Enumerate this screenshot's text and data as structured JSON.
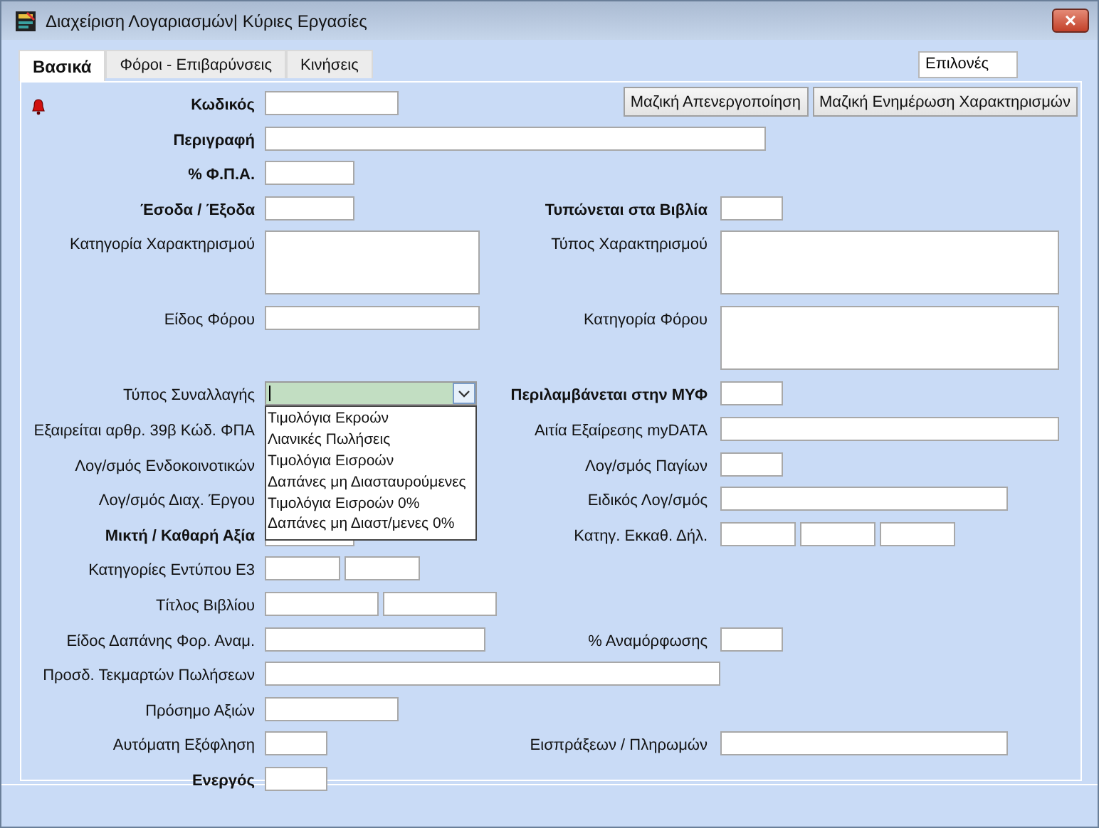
{
  "window": {
    "title": "Διαχείριση Λογαριασμών| Κύριες Εργασίες",
    "close": "×"
  },
  "tabs": [
    {
      "label": "Βασικά",
      "selected": true
    },
    {
      "label": "Φόροι - Επιβαρύνσεις",
      "selected": false
    },
    {
      "label": "Κινήσεις",
      "selected": false
    }
  ],
  "options_box": "Επιλονές",
  "toolbar": [
    "Μαζική Απενεργοποίηση",
    "Μαζική Ενημέρωση Χαρακτηρισμών"
  ],
  "rows": [
    {
      "left": {
        "label": "Κωδικός",
        "bold": true,
        "fields": [
          {
            "kind": "medium"
          }
        ]
      }
    },
    {
      "left": {
        "label": "Περιγραφή",
        "bold": true,
        "fields": [
          {
            "kind": "fullest"
          }
        ]
      }
    },
    {
      "left": {
        "label": "% Φ.Π.Α.",
        "bold": true,
        "fields": [
          {
            "kind": "short"
          }
        ]
      }
    },
    {
      "left": {
        "label": "Έσοδα / Έξοδα",
        "bold": true,
        "fields": [
          {
            "kind": "short"
          }
        ]
      },
      "right": {
        "label": "Τυπώνεται στα Βιβλία",
        "bold": true,
        "fields": [
          {
            "kind": "tiny"
          }
        ]
      }
    },
    {
      "left": {
        "label": "Κατηγορία Χαρακτηρισμού",
        "bold": false,
        "fields": [
          {
            "kind": "area-wide"
          }
        ]
      },
      "right": {
        "label": "Τύπος Χαρακτηρισμού",
        "bold": false,
        "fields": [
          {
            "kind": "area-long"
          }
        ]
      }
    },
    {
      "left": {
        "label": "Είδος Φόρου",
        "bold": false,
        "fields": [
          {
            "kind": "wide"
          }
        ]
      },
      "right": {
        "label": "Κατηγορία Φόρου",
        "bold": false,
        "fields": [
          {
            "kind": "area-long"
          }
        ]
      }
    },
    {
      "left": {
        "label": "Τύπος Συναλλαγής",
        "bold": false,
        "fields": [
          {
            "kind": "combo"
          }
        ]
      },
      "right": {
        "label": "Περιλαμβάνεται στην ΜΥΦ",
        "bold": true,
        "fields": [
          {
            "kind": "tiny"
          }
        ]
      }
    },
    {
      "left": {
        "label": "Εξαιρείται αρθρ. 39β Κώδ. ΦΠΑ",
        "bold": false
      },
      "right": {
        "label": "Αιτία Εξαίρεσης myDATA",
        "bold": false,
        "fields": [
          {
            "kind": "longer"
          }
        ]
      }
    },
    {
      "left": {
        "label": "Λογ/σμός Ενδοκοινοτικών",
        "bold": false
      },
      "right": {
        "label": "Λογ/σμός  Παγίων",
        "bold": false,
        "fields": [
          {
            "kind": "tiny"
          }
        ]
      }
    },
    {
      "left": {
        "label": "Λογ/σμός Διαχ. Έργου",
        "bold": false
      },
      "right": {
        "label": "Ειδικός Λογ/σμός",
        "bold": false,
        "fields": [
          {
            "kind": "long"
          }
        ]
      }
    },
    {
      "left": {
        "label": "Μικτή  / Καθαρή Αξία",
        "bold": true,
        "fields": [
          {
            "kind": "short"
          }
        ]
      },
      "right": {
        "label": "Κατηγ. Εκκαθ. Δήλ.",
        "bold": false,
        "fields": [
          {
            "kind": "small"
          },
          {
            "kind": "small"
          },
          {
            "kind": "small"
          }
        ]
      }
    },
    {
      "left": {
        "label": "Κατηγορίες Εντύπου Ε3",
        "bold": false,
        "fields": [
          {
            "kind": "small"
          },
          {
            "kind": "small"
          }
        ]
      }
    },
    {
      "left": {
        "label": "Τίτλος Βιβλίου",
        "bold": false,
        "fields": [
          {
            "kind": "compact"
          },
          {
            "kind": "compact"
          }
        ]
      }
    },
    {
      "left": {
        "label": "Είδος Δαπάνης Φορ. Αναμ.",
        "bold": false,
        "fields": [
          {
            "kind": "wider"
          }
        ]
      },
      "right": {
        "label": "% Αναμόρφωσης",
        "bold": false,
        "fields": [
          {
            "kind": "tiny"
          }
        ]
      }
    },
    {
      "left": {
        "label": "Προσδ. Τεκμαρτών Πωλήσεων",
        "bold": false,
        "fields": [
          {
            "kind": "full"
          }
        ]
      }
    },
    {
      "left": {
        "label": "Πρόσημο Αξιών",
        "bold": false,
        "fields": [
          {
            "kind": "medium"
          }
        ]
      }
    },
    {
      "left": {
        "label": "Αυτόματη Εξόφληση",
        "bold": false,
        "fields": [
          {
            "kind": "tiny"
          }
        ]
      },
      "right": {
        "label": "Εισπράξεων / Πληρωμών",
        "bold": false,
        "fields": [
          {
            "kind": "long"
          }
        ]
      }
    },
    {
      "left": {
        "label": "Ενεργός",
        "bold": true,
        "fields": [
          {
            "kind": "tiny"
          }
        ]
      }
    }
  ],
  "dropdown": {
    "options": [
      "Τιμολόγια Εκροών",
      "Λιανικές Πωλήσεις",
      "Τιμολόγια Εισροών",
      "Δαπάνες μη Διασταυρούμενες",
      "Τιμολόγια Εισροών 0%",
      "Δαπάνες μη Διαστ/μενες 0%"
    ]
  }
}
